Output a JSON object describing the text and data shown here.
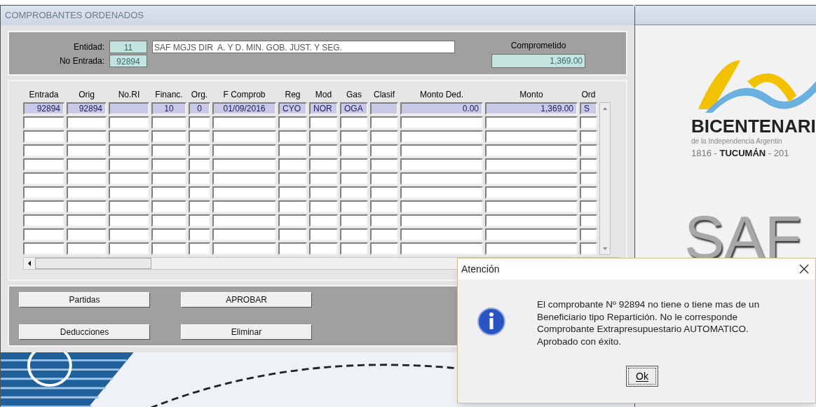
{
  "window": {
    "title": "COMPROBANTES ORDENADOS"
  },
  "header": {
    "entidad_label": "Entidad:",
    "entidad_code": "11",
    "entidad_name": "SAF MGJS DIR  A. Y D. MIN. GOB. JUST. Y SEG.",
    "entrada_label": "No Entrada:",
    "entrada_value": "92894",
    "comprometido_label": "Comprometido",
    "comprometido_value": "1,369.00"
  },
  "table": {
    "columns": [
      "Entrada",
      "Orig",
      "No.RI",
      "Financ.",
      "Org.",
      "F Comprob",
      "Reg",
      "Mod",
      "Gas",
      "Clasif",
      "Monto Ded.",
      "Monto",
      "Ord"
    ],
    "rows": [
      [
        "92894",
        "92894",
        "",
        "10",
        "0",
        "01/09/2016",
        "CYO",
        "NOR",
        "OGA",
        "",
        "0.00",
        "1,369.00",
        "S"
      ]
    ]
  },
  "buttons": [
    [
      "Partidas",
      "APROBAR"
    ],
    [
      "Deducciones",
      "Eliminar"
    ]
  ],
  "logo": {
    "title": "BICENTENARI",
    "subtitle": "de la Independencia Argentin",
    "year_start": "1816 - ",
    "city": "TUCUMÁN",
    "year_end": " - 201",
    "brand": "SAF"
  },
  "dialog": {
    "title": "Atención",
    "message": "El comprobante Nº 92894 no tiene o tiene mas de un Beneficiario tipo Repartición. No le corresponde Comprobante Extrapresupuestario AUTOMATICO. Aprobado con éxito.",
    "button": "Ok"
  }
}
